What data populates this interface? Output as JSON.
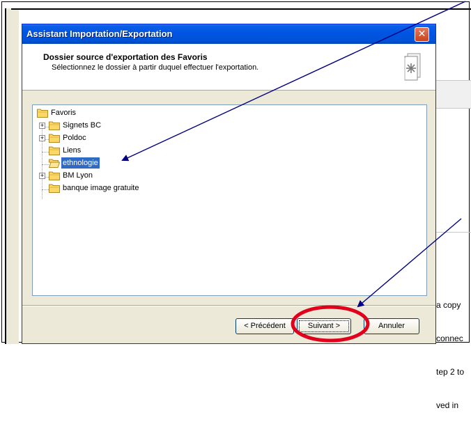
{
  "background": {
    "partial_text_lines": [
      "a copy",
      "connec",
      "tep 2 to",
      "ved in"
    ]
  },
  "dialog": {
    "title": "Assistant Importation/Exportation",
    "close_glyph": "✕",
    "header": {
      "title": "Dossier source d'exportation des Favoris",
      "subtitle": "Sélectionnez le dossier à partir duquel effectuer l'exportation."
    },
    "tree": {
      "root": "Favoris",
      "items": [
        {
          "label": "Signets BC",
          "expandable": true
        },
        {
          "label": "Poldoc",
          "expandable": true
        },
        {
          "label": "Liens",
          "expandable": false
        },
        {
          "label": "ethnologie",
          "expandable": false,
          "selected": true
        },
        {
          "label": "BM Lyon",
          "expandable": true
        },
        {
          "label": "banque image gratuite",
          "expandable": false
        }
      ]
    },
    "buttons": {
      "back": "< Précédent",
      "next": "Suivant >",
      "cancel": "Annuler"
    }
  },
  "icons": {
    "close": "close-icon",
    "folder": "folder-icon",
    "expand": "plus-expander-icon",
    "wizard": "favorites-export-icon"
  },
  "colors": {
    "title_bar": "#0054e3",
    "selection": "#316ac5",
    "annotation_arrow": "#000080",
    "annotation_circle": "#e0001b",
    "dialog_face": "#ece9d8"
  }
}
